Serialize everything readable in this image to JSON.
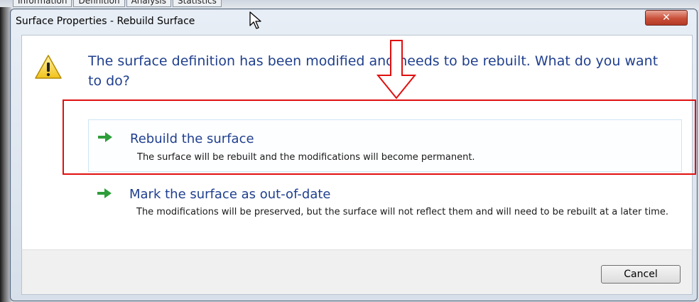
{
  "background": {
    "tabs": [
      "Information",
      "Definition",
      "Analysis",
      "Statistics"
    ]
  },
  "dialog": {
    "title": "Surface Properties - Rebuild Surface",
    "close_icon": "close-icon",
    "warning_icon": "warning-icon",
    "heading": "The surface definition has been modified and needs to be rebuilt. What do you want to do?",
    "options": [
      {
        "title": "Rebuild the surface",
        "description": "The surface will be rebuilt and the modifications will become permanent.",
        "icon": "green-arrow-icon"
      },
      {
        "title": "Mark the surface as out-of-date",
        "description": "The modifications will be preserved, but the surface will not reflect them and will need to be rebuilt at a later time.",
        "icon": "green-arrow-icon"
      }
    ],
    "cancel_label": "Cancel"
  },
  "annotation": {
    "color": "#e01010",
    "highlight": "Rebuild the surface"
  },
  "colors": {
    "heading": "#1f3f8e",
    "close_button": "#c9503a",
    "arrow": "#2e9e3a"
  }
}
